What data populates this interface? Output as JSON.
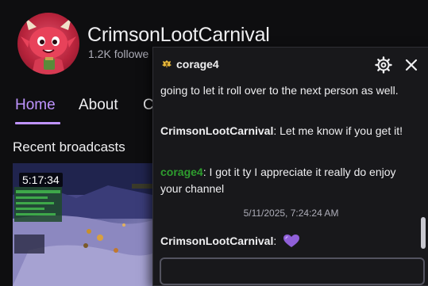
{
  "channel": {
    "name": "CrimsonLootCarnival",
    "followers": "1.2K followe"
  },
  "nav": {
    "tabs": [
      {
        "label": "Home",
        "active": true
      },
      {
        "label": "About"
      },
      {
        "label": "C"
      }
    ]
  },
  "recent": {
    "title": "Recent broadcasts",
    "video": {
      "duration": "5:17:34"
    }
  },
  "whisper": {
    "username": "corage4",
    "messages": [
      {
        "author": "",
        "text": "going to let it roll over to the next person as well."
      },
      {
        "author": "CrimsonLootCarnival",
        "sep": ":",
        "text": " Let me know if you get it!"
      },
      {
        "author": "corage4",
        "sep": ":",
        "text": " I got it ty I appreciate it really do enjoy your channel"
      },
      {
        "author": "CrimsonLootCarnival",
        "sep": ":",
        "text": ""
      }
    ],
    "timestamp": "5/11/2025, 7:24:24 AM",
    "input": {
      "value": "",
      "placeholder": ""
    }
  },
  "colors": {
    "accent": "#bf94ff",
    "viewer_name": "#2e9d2e",
    "background": "#0e0e10",
    "panel": "#18181b"
  },
  "icons": {
    "badge": "gold-wing-badge-icon",
    "settings": "gear-icon",
    "close": "close-icon",
    "emote": "purple-heart-emote-icon"
  }
}
